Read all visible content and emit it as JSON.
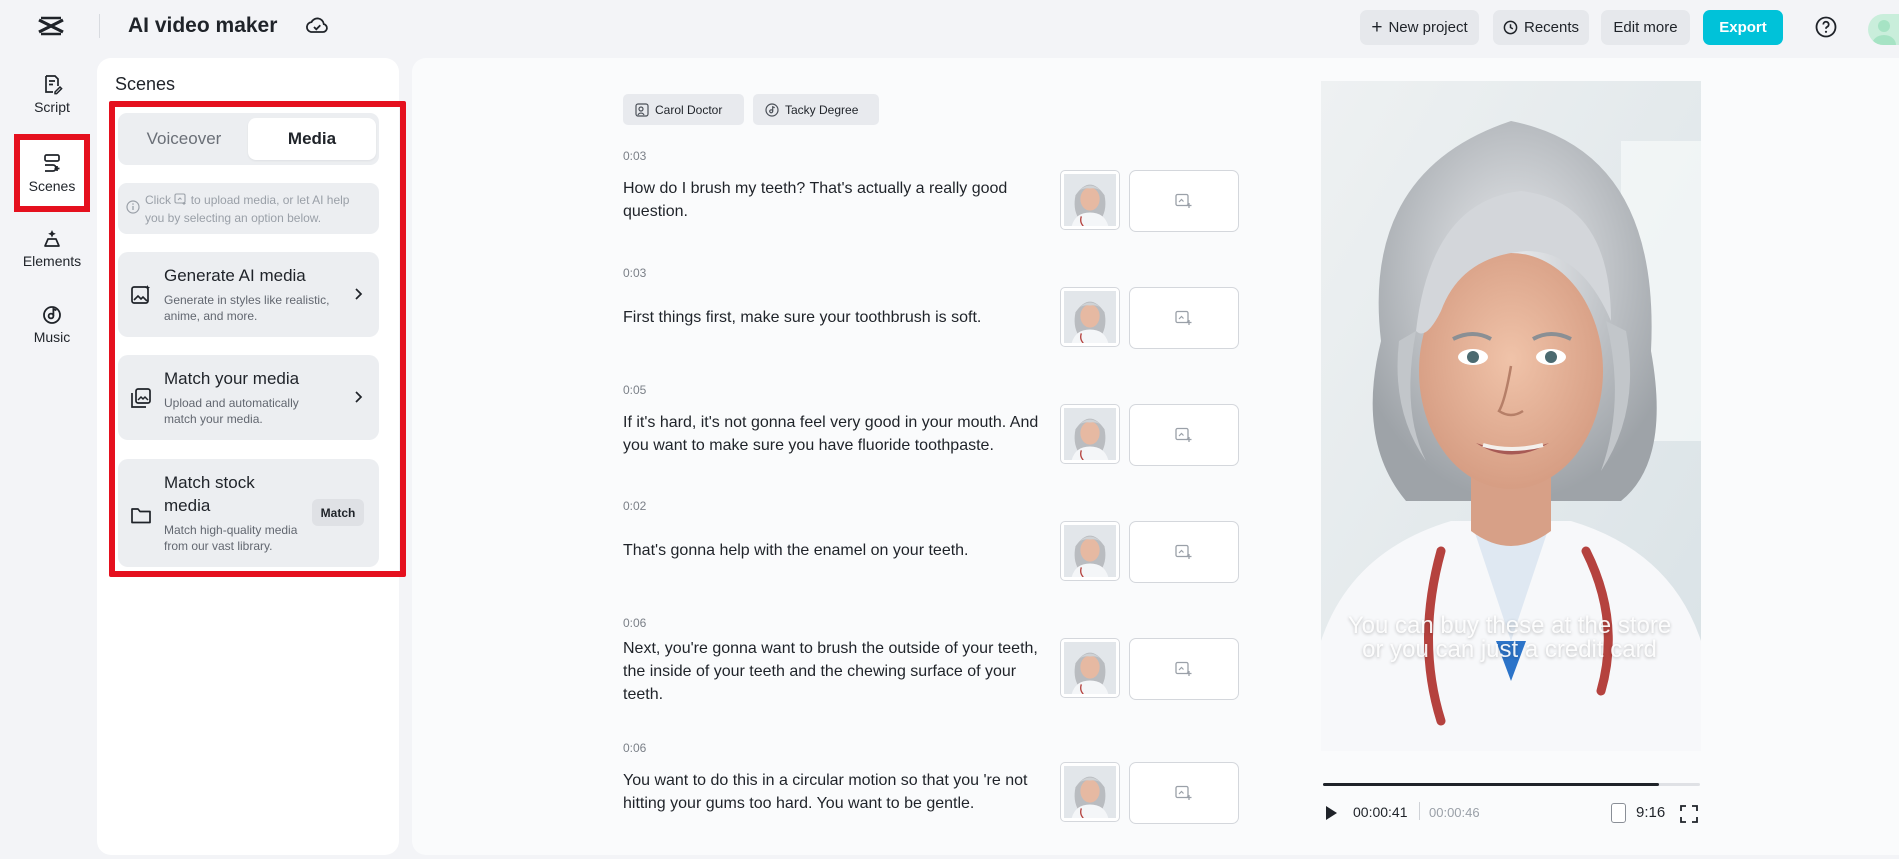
{
  "header": {
    "logo_icon": "capcut-logo-icon",
    "title": "AI video maker",
    "cloud_icon": "cloud-sync-icon",
    "new_project": "New project",
    "recents": "Recents",
    "edit_more": "Edit more",
    "export": "Export",
    "help_icon": "help-circle-icon",
    "accent_color": "#00c2d9"
  },
  "rail": {
    "items": [
      {
        "label": "Script",
        "icon": "script-icon"
      },
      {
        "label": "Scenes",
        "icon": "scenes-icon"
      },
      {
        "label": "Elements",
        "icon": "elements-icon"
      },
      {
        "label": "Music",
        "icon": "music-icon"
      }
    ],
    "highlight_color": "#e5101e"
  },
  "scenes_panel": {
    "title": "Scenes",
    "tabs": [
      "Voiceover",
      "Media"
    ],
    "active_tab": "Media",
    "hint": {
      "before_icon": "Click",
      "after_icon": "to upload media, or let AI help you by selecting an option below."
    },
    "cards": [
      {
        "title": "Generate AI media",
        "desc": "Generate in styles like realistic, anime, and more.",
        "icon": "ai-image-icon"
      },
      {
        "title": "Match your media",
        "desc": "Upload and automatically match your media.",
        "icon": "gallery-icon"
      },
      {
        "title": "Match stock media",
        "desc": "Match high-quality media from our vast library.",
        "icon": "folder-icon",
        "button": "Match"
      }
    ]
  },
  "script": {
    "chips": [
      "Carol Doctor",
      "Tacky Degree"
    ],
    "scenes": [
      {
        "time": "0:03",
        "text": "How do I brush my teeth? That's actually a really good question."
      },
      {
        "time": "0:03",
        "text": "First things first, make sure your toothbrush is soft."
      },
      {
        "time": "0:05",
        "text": "If it's hard, it's not gonna feel very good in your mouth. And you want to make sure you have fluoride toothpaste."
      },
      {
        "time": "0:02",
        "text": "That's gonna help with the enamel on your teeth."
      },
      {
        "time": "0:06",
        "text": "Next, you're gonna want to brush the outside of your teeth, the inside of your teeth and the chewing surface of your teeth."
      },
      {
        "time": "0:06",
        "text": "You want to do this in a circular motion so that you 're not hitting your gums too hard. You want to be gentle."
      }
    ]
  },
  "preview": {
    "caption": "You can buy these at the store or you can just a credit card",
    "current_time": "00:00:41",
    "total_time": "00:00:46",
    "progress_fraction": 0.89,
    "aspect_ratio": "9:16"
  }
}
